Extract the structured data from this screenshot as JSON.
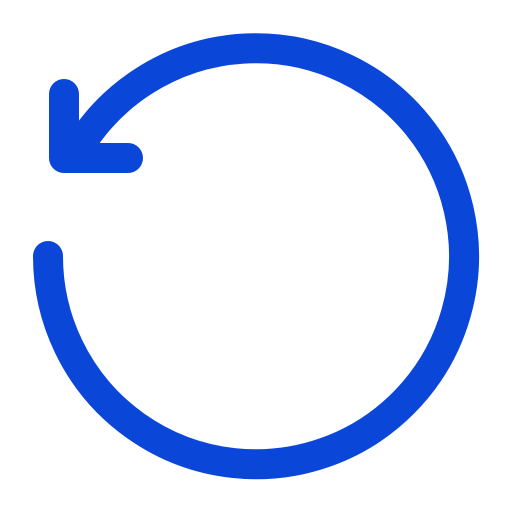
{
  "icon": {
    "name": "rotate-ccw-icon",
    "color": "#0A47D9",
    "background": "#FFFFFF"
  }
}
